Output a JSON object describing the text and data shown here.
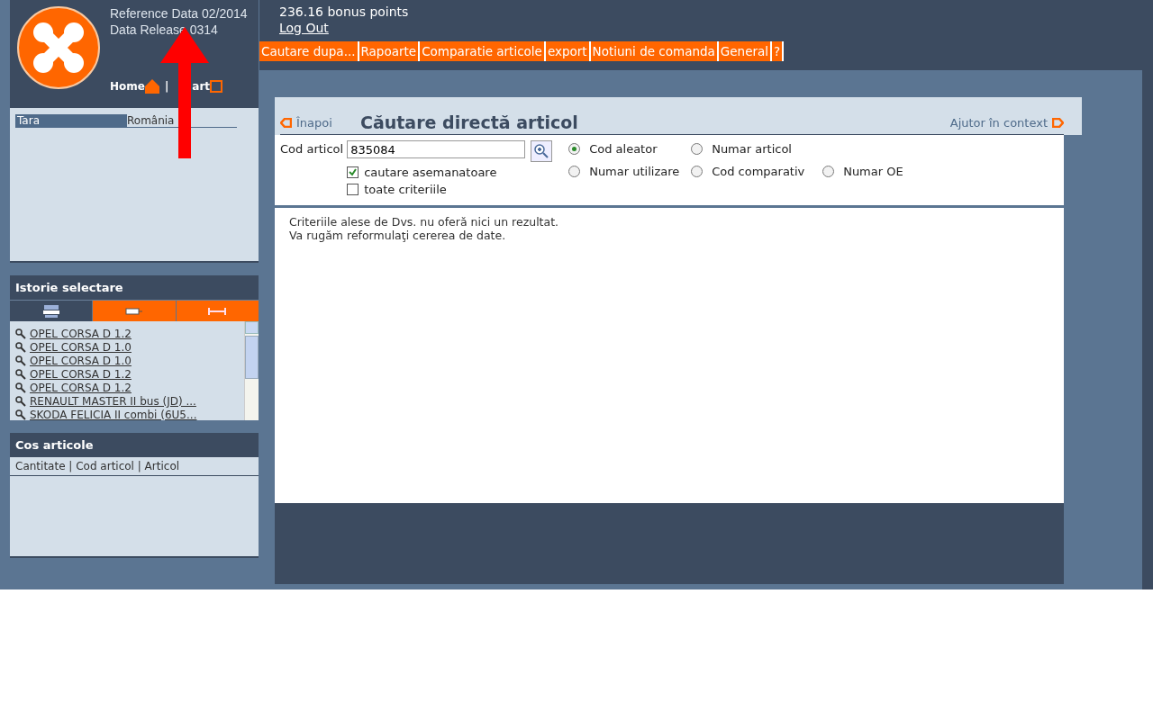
{
  "header": {
    "reference": "Reference Data 02/2014",
    "release": "Data Release 0314",
    "home": "Home",
    "separator": "|",
    "cart": "art",
    "bonus": "236.16 bonus points",
    "logout": "Log Out"
  },
  "menu": [
    {
      "label": "Cautare dupa...",
      "selected": false
    },
    {
      "label": "Rapoarte",
      "selected": false
    },
    {
      "label": "Comparatie articole",
      "selected": false
    },
    {
      "label": "export",
      "selected": false
    },
    {
      "label": "Notiuni de comanda",
      "selected": false
    },
    {
      "label": "General",
      "selected": false
    },
    {
      "label": "?",
      "selected": false
    }
  ],
  "country": {
    "label": "Tara",
    "value": "România"
  },
  "history": {
    "title": "Istorie selectare",
    "tabs": [
      {
        "kind": "car",
        "selected": true
      },
      {
        "kind": "truck",
        "selected": false
      },
      {
        "kind": "axle",
        "selected": false
      }
    ],
    "items": [
      "OPEL CORSA D 1.2",
      "OPEL CORSA D 1.0",
      "OPEL CORSA D 1.0",
      "OPEL CORSA D 1.2",
      "OPEL CORSA D 1.2",
      "RENAULT MASTER II bus (JD) ...",
      "SKODA FELICIA II combi (6U5..."
    ]
  },
  "cart": {
    "title": "Cos articole",
    "columns": "Cantitate | Cod articol | Articol"
  },
  "search": {
    "back": "Înapoi",
    "title": "Căutare directă articol",
    "help": "Ajutor în context",
    "field_label": "Cod articol",
    "value": "835084",
    "checkboxes": [
      {
        "label": "cautare asemanatoare",
        "checked": true
      },
      {
        "label": "toate criteriile",
        "checked": false
      }
    ],
    "option_rows": [
      [
        {
          "label": "Cod aleator",
          "selected": true
        },
        {
          "label": "Numar articol",
          "selected": false
        }
      ],
      [
        {
          "label": "Numar utilizare",
          "selected": false
        },
        {
          "label": "Cod comparativ",
          "selected": false
        },
        {
          "label": "Numar OE",
          "selected": false
        }
      ]
    ],
    "message": [
      "Criteriile alese de Dvs. nu oferă nici un rezultat.",
      "Va rugăm reformulaţi cererea de date."
    ]
  }
}
